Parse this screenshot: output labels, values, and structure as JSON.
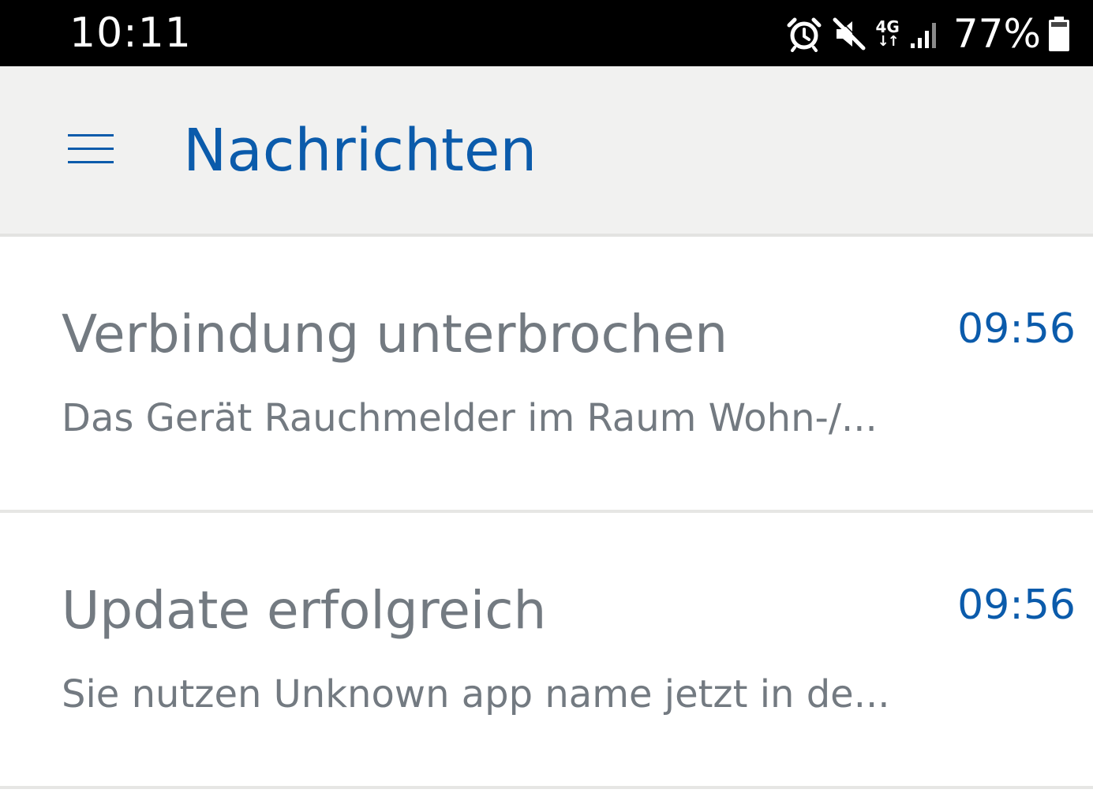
{
  "status_bar": {
    "time": "10:11",
    "icons": [
      "alarm-icon",
      "mute-icon",
      "lte-icon",
      "signal-icon",
      "battery-icon"
    ],
    "network_label": "4G",
    "battery_percent": "77%"
  },
  "app_bar": {
    "menu_icon": "hamburger-menu-icon",
    "title": "Nachrichten"
  },
  "messages": [
    {
      "title": "Verbindung unterbrochen",
      "time": "09:56",
      "preview": "Das Gerät Rauchmelder im Raum Wohn-/..."
    },
    {
      "title": "Update erfolgreich",
      "time": "09:56",
      "preview": "Sie nutzen Unknown app name jetzt in de..."
    }
  ],
  "colors": {
    "accent": "#0b5bab",
    "text_secondary": "#737a81",
    "app_bar_bg": "#f1f1f0",
    "status_bar_bg": "#000000"
  }
}
